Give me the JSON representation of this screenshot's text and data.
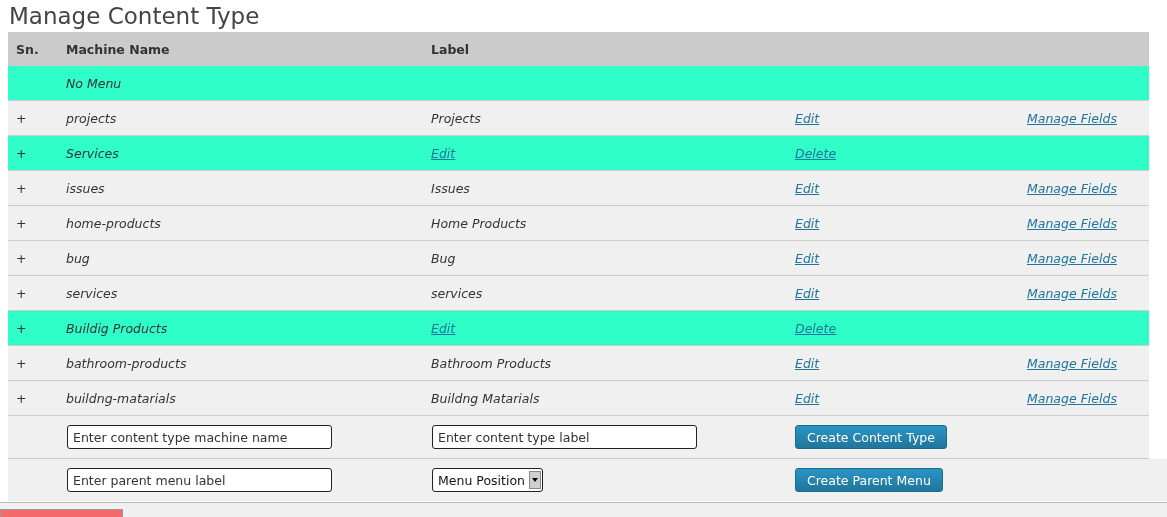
{
  "title": "Manage Content Type",
  "table": {
    "columns": [
      "Sn.",
      "Machine Name",
      "Label"
    ],
    "rows": [
      {
        "kind": "menu",
        "name": "No Menu"
      },
      {
        "kind": "type",
        "expander": "+",
        "name": "projects",
        "label": "Projects",
        "edit": "Edit",
        "manage": "Manage Fields"
      },
      {
        "kind": "menu",
        "expander": "+",
        "name": "Services",
        "edit": "Edit",
        "delete": "Delete"
      },
      {
        "kind": "type",
        "expander": "+",
        "name": "issues",
        "label": "Issues",
        "edit": "Edit",
        "manage": "Manage Fields"
      },
      {
        "kind": "type",
        "expander": "+",
        "name": "home-products",
        "label": "Home Products",
        "edit": "Edit",
        "manage": "Manage Fields"
      },
      {
        "kind": "type",
        "expander": "+",
        "name": "bug",
        "label": "Bug",
        "edit": "Edit",
        "manage": "Manage Fields"
      },
      {
        "kind": "type",
        "expander": "+",
        "name": "services",
        "label": "services",
        "edit": "Edit",
        "manage": "Manage Fields"
      },
      {
        "kind": "menu",
        "expander": "+",
        "name": "Buildig Products",
        "edit": "Edit",
        "delete": "Delete"
      },
      {
        "kind": "type",
        "expander": "+",
        "name": "bathroom-products",
        "label": "Bathroom Products",
        "edit": "Edit",
        "manage": "Manage Fields"
      },
      {
        "kind": "type",
        "expander": "+",
        "name": "buildng-matarials",
        "label": "Buildng Matarials",
        "edit": "Edit",
        "manage": "Manage Fields"
      }
    ]
  },
  "create_type_form": {
    "name_placeholder": "Enter content type machine name",
    "label_placeholder": "Enter content type label",
    "button": "Create Content Type"
  },
  "create_menu_form": {
    "label_placeholder": "Enter parent menu label",
    "position_select": "Menu Position",
    "button": "Create Parent Menu"
  }
}
